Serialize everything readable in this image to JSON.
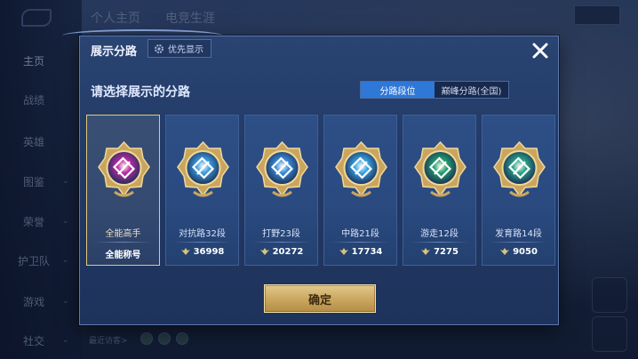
{
  "background": {
    "nav_items": [
      "主页",
      "战绩",
      "英雄",
      "图鉴",
      "荣誉",
      "护卫队",
      "游戏",
      "社交"
    ],
    "top_tabs": [
      "个人主页",
      "电竞生涯"
    ],
    "bottom_text": "最近访客>"
  },
  "modal": {
    "title": "展示分路",
    "priority_label": "优先显示",
    "prompt": "请选择展示的分路",
    "segments": [
      {
        "label": "分路段位",
        "active": true
      },
      {
        "label": "巅峰分路(全国)",
        "active": false
      }
    ],
    "cards": [
      {
        "rank_label": "全能高手",
        "score": "全能称号",
        "emblem": "all-rounder-emblem",
        "color": "#c02aa8",
        "selected": true,
        "show_wing": false
      },
      {
        "rank_label": "对抗路32段",
        "score": "36998",
        "emblem": "clash-lane-emblem",
        "color": "#3fa0e6",
        "selected": false,
        "show_wing": true
      },
      {
        "rank_label": "打野23段",
        "score": "20272",
        "emblem": "jungle-emblem",
        "color": "#3a8fde",
        "selected": false,
        "show_wing": true
      },
      {
        "rank_label": "中路21段",
        "score": "17734",
        "emblem": "mid-lane-emblem",
        "color": "#3aa6ea",
        "selected": false,
        "show_wing": true
      },
      {
        "rank_label": "游走12段",
        "score": "7275",
        "emblem": "roam-emblem",
        "color": "#23a36e",
        "selected": false,
        "show_wing": true
      },
      {
        "rank_label": "发育路14段",
        "score": "9050",
        "emblem": "farm-lane-emblem",
        "color": "#2aa88a",
        "selected": false,
        "show_wing": true
      }
    ],
    "confirm_label": "确定"
  },
  "colors": {
    "accent_blue": "#2f78d8",
    "gold": "#e6c77a"
  }
}
